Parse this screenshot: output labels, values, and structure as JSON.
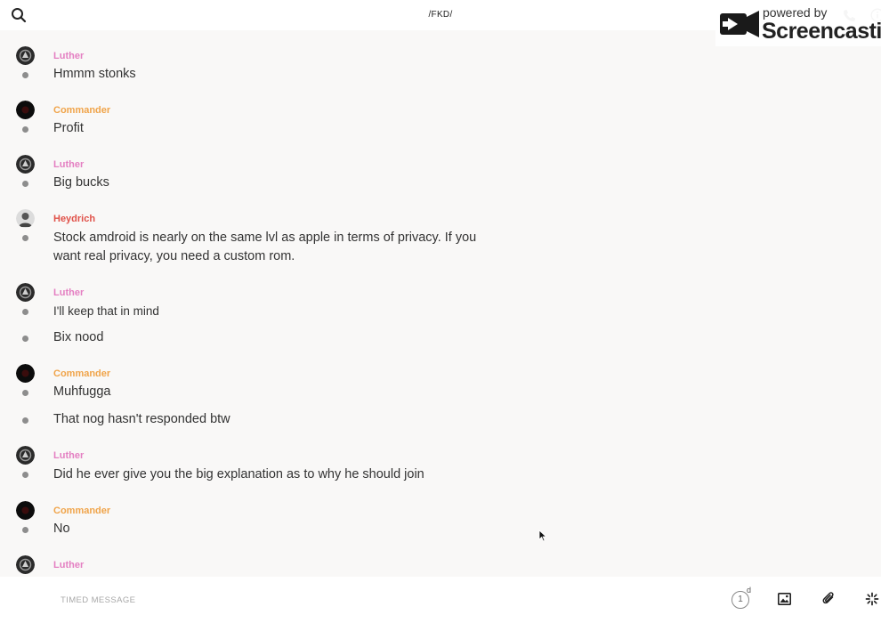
{
  "header": {
    "title": "/FKD/",
    "search_icon": "search-icon",
    "call_icon": "phone-icon",
    "info_icon": "info-icon"
  },
  "watermark": {
    "powered": "powered by",
    "brand": "Screencastify"
  },
  "colors": {
    "luther": "#e47fc2",
    "commander": "#f0a44a",
    "heydrich": "#e0524a",
    "dot": "#8d8d8d"
  },
  "messages": [
    {
      "author": "Luther",
      "text": "Hmmm stonks"
    },
    {
      "author": "Commander",
      "text": "Profit"
    },
    {
      "author": "Luther",
      "text": "Big bucks"
    },
    {
      "author": "Heydrich",
      "text": "Stock amdroid is nearly on the same lvl as apple in terms of privacy. If you want real privacy, you need a custom rom."
    },
    {
      "author": "Luther",
      "text": "I'll keep that in mind"
    },
    {
      "text": "Bix nood"
    },
    {
      "author": "Commander",
      "text": "Muhfugga"
    },
    {
      "text": "That nog hasn't responded btw"
    },
    {
      "author": "Luther",
      "text": "Did he ever give you the big explanation as to why he should join"
    },
    {
      "author": "Commander",
      "text": "No"
    },
    {
      "author": "Luther"
    }
  ],
  "composer": {
    "placeholder": "TIMED MESSAGE",
    "timer_value": "1",
    "timer_unit": "d",
    "image_icon": "image-icon",
    "attach_icon": "paperclip-icon",
    "sticker_icon": "sparkle-icon"
  }
}
